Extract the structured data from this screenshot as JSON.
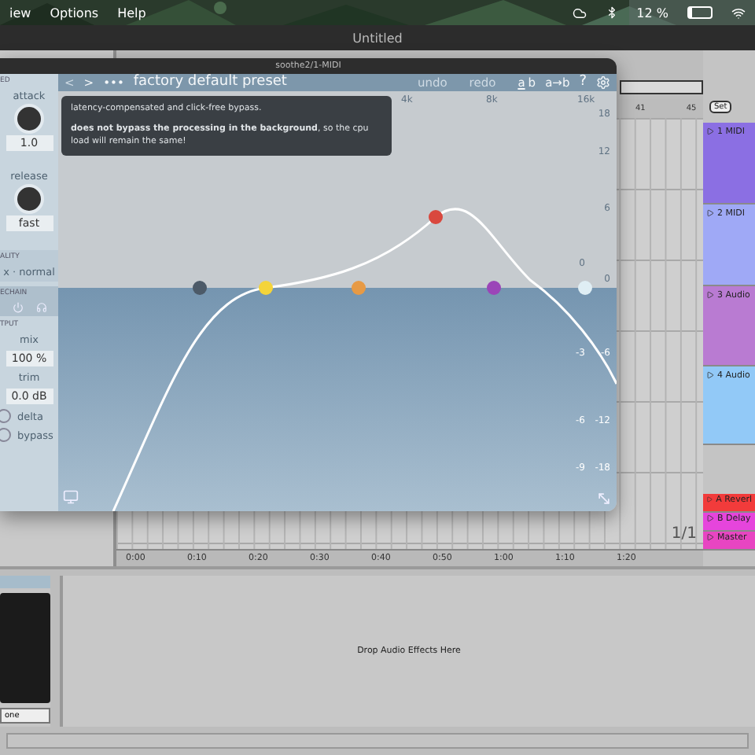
{
  "menu_bar": {
    "items": [
      "iew",
      "Options",
      "Help"
    ],
    "battery": "12 %"
  },
  "window": {
    "title": "Untitled"
  },
  "arrangement": {
    "bar_numbers": [
      "41",
      "45"
    ],
    "set_button": "Set",
    "tracks": [
      {
        "name": "1 MIDI",
        "color": "#8b6fe3"
      },
      {
        "name": "2 MIDI",
        "color": "#9fa9f6"
      },
      {
        "name": "3 Audio",
        "color": "#b97bd2"
      },
      {
        "name": "4 Audio",
        "color": "#92c9f7"
      }
    ],
    "return_tracks": [
      {
        "name": "A Reverl",
        "color": "#f23b3b"
      },
      {
        "name": "B Delay",
        "color": "#e645dc"
      },
      {
        "name": "Master",
        "color": "#e845c2"
      }
    ],
    "loop_indicator": "1/1",
    "time_ruler": [
      "0:00",
      "0:10",
      "0:20",
      "0:30",
      "0:40",
      "0:50",
      "1:00",
      "1:10",
      "1:20"
    ]
  },
  "plugin": {
    "title": "soothe2/1-MIDI",
    "back": "<",
    "forward": ">",
    "more": "•••",
    "preset": "factory default preset",
    "undo": "undo",
    "redo": "redo",
    "ab_slots": [
      {
        "label": "a",
        "selected": true
      },
      {
        "label": "b",
        "selected": false
      }
    ],
    "copy": "a→b",
    "help": "?",
    "sidebar": {
      "heading": "ED",
      "knobs": [
        {
          "label": "attack",
          "value": "1.0"
        },
        {
          "label": "release",
          "value": "fast"
        }
      ],
      "quality": {
        "heading": "ALITY",
        "value": "x · normal"
      },
      "sidechain": {
        "heading": "ECHAIN"
      },
      "output": {
        "heading": "TPUT",
        "fields": [
          {
            "label": "mix",
            "value": "100 %"
          },
          {
            "label": "trim",
            "value": "0.0 dB"
          }
        ]
      },
      "toggles": [
        {
          "label": "delta",
          "on": false
        },
        {
          "label": "bypass",
          "on": false
        }
      ]
    },
    "tooltip": {
      "lines": [
        "latency-compensated and click-free bypass.",
        "**does not bypass the processing in the background**, so the cpu load will remain the same!"
      ]
    },
    "graph": {
      "freq_labels": [
        "4k",
        "8k",
        "16k"
      ],
      "gain_labels": [
        "18",
        "12",
        "6",
        "0",
        "-6",
        "-12",
        "-18"
      ],
      "depth_labels": [
        "0",
        "-3",
        "-6",
        "-9"
      ],
      "bands": [
        {
          "color": "#4c5a68"
        },
        {
          "color": "#f4d43a"
        },
        {
          "color": "#e79a45"
        },
        {
          "color": "#d9483e"
        },
        {
          "color": "#9b45b8"
        },
        {
          "color": "#dfeef4"
        }
      ]
    }
  },
  "device": {
    "dropdown": "one",
    "drop_hint": "Drop Audio Effects Here"
  }
}
